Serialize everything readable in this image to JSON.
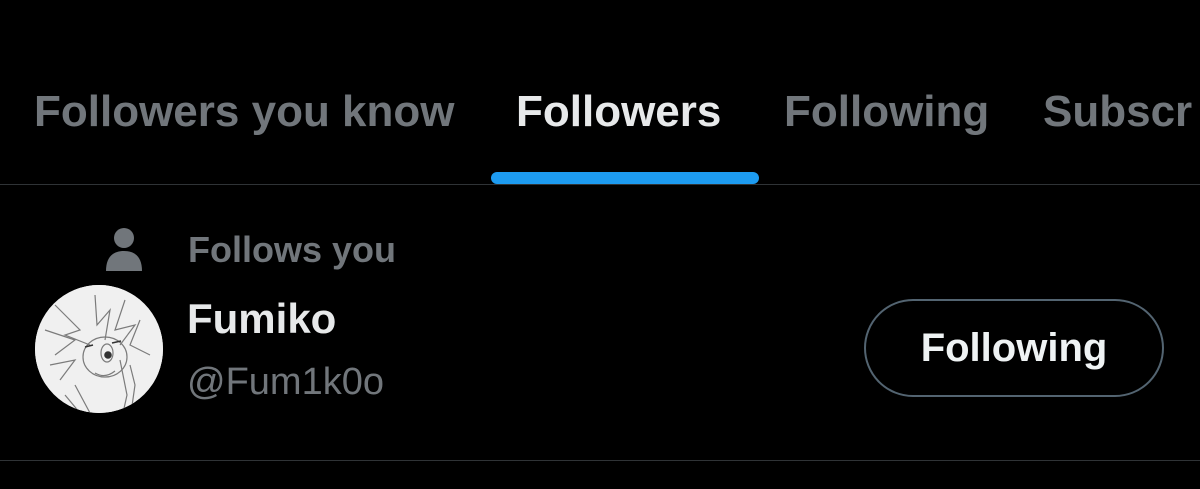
{
  "tabs": [
    {
      "label": "Followers you know",
      "active": false
    },
    {
      "label": "Followers",
      "active": true
    },
    {
      "label": "Following",
      "active": false
    },
    {
      "label": "Subscr",
      "active": false
    }
  ],
  "colors": {
    "background": "#000000",
    "accent": "#1d9bf0",
    "primary_text": "#e7e9ea",
    "secondary_text": "#71767b",
    "divider": "#2f3336"
  },
  "follower": {
    "context_icon": "person-icon",
    "context_label": "Follows you",
    "display_name": "Fumiko",
    "handle": "@Fum1k0o",
    "button_label": "Following"
  }
}
